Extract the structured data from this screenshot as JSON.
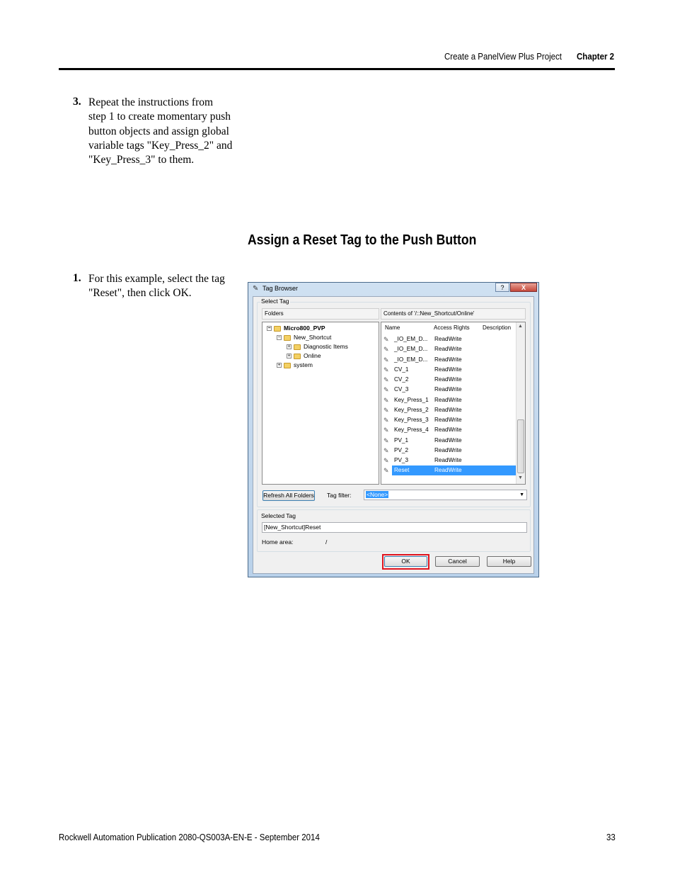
{
  "header": {
    "section_title": "Create a PanelView Plus Project",
    "chapter": "Chapter 2"
  },
  "step3": {
    "number": "3.",
    "lines": [
      "Repeat the instructions from",
      "step 1 to create momentary push",
      "button objects and assign global",
      "variable tags \"Key_Press_2\" and",
      "\"Key_Press_3\" to them."
    ]
  },
  "section_heading": "Assign a Reset Tag to the Push Button",
  "step1": {
    "number": "1.",
    "lines": [
      "For this example, select the tag",
      "\"Reset\", then click OK."
    ]
  },
  "dialog": {
    "title": "Tag Browser",
    "help_label": "?",
    "close_label": "X",
    "select_tag_label": "Select Tag",
    "folders_header": "Folders",
    "contents_header": "Contents of '/::New_Shortcut/Online'",
    "tree": [
      {
        "label": "Micro800_PVP",
        "expander": "⊟"
      },
      {
        "label": "New_Shortcut",
        "expander": "⊟"
      },
      {
        "label": "Diagnostic Items",
        "expander": "⊞"
      },
      {
        "label": "Online",
        "expander": "⊞"
      },
      {
        "label": "system",
        "expander": "⊞"
      }
    ],
    "columns": {
      "name": "Name",
      "access": "Access Rights",
      "description": "Description"
    },
    "tags": [
      {
        "name": "_IO_EM_D...",
        "access": "ReadWrite"
      },
      {
        "name": "_IO_EM_D...",
        "access": "ReadWrite"
      },
      {
        "name": "_IO_EM_D...",
        "access": "ReadWrite"
      },
      {
        "name": "CV_1",
        "access": "ReadWrite"
      },
      {
        "name": "CV_2",
        "access": "ReadWrite"
      },
      {
        "name": "CV_3",
        "access": "ReadWrite"
      },
      {
        "name": "Key_Press_1",
        "access": "ReadWrite"
      },
      {
        "name": "Key_Press_2",
        "access": "ReadWrite"
      },
      {
        "name": "Key_Press_3",
        "access": "ReadWrite"
      },
      {
        "name": "Key_Press_4",
        "access": "ReadWrite"
      },
      {
        "name": "PV_1",
        "access": "ReadWrite"
      },
      {
        "name": "PV_2",
        "access": "ReadWrite"
      },
      {
        "name": "PV_3",
        "access": "ReadWrite"
      },
      {
        "name": "Reset",
        "access": "ReadWrite",
        "selected": true
      }
    ],
    "refresh_button": "Refresh All Folders",
    "tag_filter_label": "Tag filter:",
    "tag_filter_value": "<None>",
    "selected_tag_label": "Selected Tag",
    "selected_tag_value": "[New_Shortcut]Reset",
    "home_area_label": "Home area:",
    "home_area_value": "/",
    "ok_button": "OK",
    "cancel_button": "Cancel",
    "help_button": "Help",
    "colors": {
      "selection": "#3399ff",
      "ok_highlight": "#e0141e"
    }
  },
  "footer": {
    "publication": "Rockwell Automation Publication 2080-QS003A-EN-E - September 2014",
    "page_number": "33"
  }
}
